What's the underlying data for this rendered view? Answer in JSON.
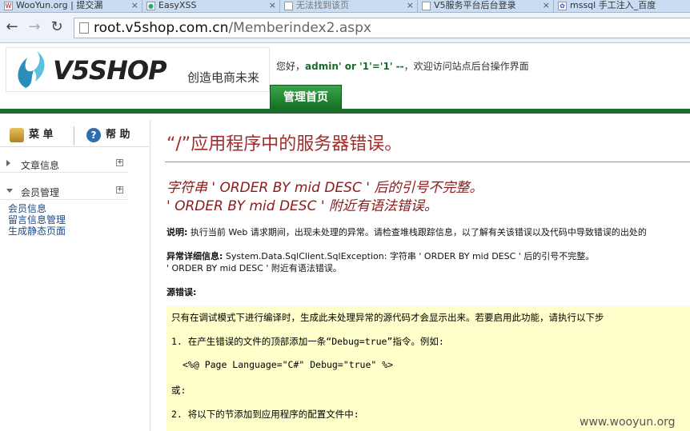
{
  "browser": {
    "tabs": [
      {
        "label": "WooYun.org | 提交漏",
        "icon": "wooyun-favicon-icon"
      },
      {
        "label": "EasyXSS",
        "icon": "easyxss-favicon-icon"
      },
      {
        "label": "无法找到该页",
        "icon": "blank-page-icon"
      },
      {
        "label": "V5服务平台后台登录",
        "icon": "blank-page-icon"
      },
      {
        "label": "mssql 手工注入_百度",
        "icon": "baidu-favicon-icon"
      }
    ],
    "url_host": "root.v5shop.com.cn",
    "url_path": "/Memberindex2.aspx"
  },
  "header": {
    "logo_text": "V5SHOP",
    "slogan": "创造电商未来",
    "greeting_prefix": "您好，",
    "username": "admin' or '1'='1' --",
    "greeting_suffix": "，欢迎访问站点后台操作界面",
    "nav_tab": "管理首页"
  },
  "sidebar": {
    "menu_label": "菜 单",
    "help_label": "帮 助",
    "groups": [
      {
        "label": "文章信息",
        "expanded": false
      },
      {
        "label": "会员管理",
        "expanded": true
      }
    ],
    "items": [
      "会员信息",
      "留言信息管理",
      "生成静态页面"
    ]
  },
  "error": {
    "title": "“/”应用程序中的服务器错误。",
    "sub1": "字符串 '    ORDER BY mid DESC ' 后的引号不完整。",
    "sub2": "'    ORDER BY mid DESC ' 附近有语法错误。",
    "desc_label": "说明:",
    "desc_text": " 执行当前 Web 请求期间，出现未处理的异常。请检查堆栈跟踪信息，以了解有关该错误以及代码中导致错误的出处的",
    "exception_label": "异常详细信息:",
    "exception_text": " System.Data.SqlClient.SqlException: 字符串 '    ORDER BY mid DESC ' 后的引号不完整。",
    "exception_text2": "'    ORDER BY mid DESC ' 附近有语法错误。",
    "source_label": "源错误:",
    "source_lines": [
      "只有在调试模式下进行编译时，生成此未处理异常的源代码才会显示出来。若要启用此功能，请执行以下步",
      "1. 在产生错误的文件的顶部添加一条“Debug=true”指令。例如:",
      "<%@ Page Language=\"C#\" Debug=\"true\" %>",
      "或:",
      "2. 将以下的节添加到应用程序的配置文件中:"
    ]
  },
  "watermark": "www.wooyun.org"
}
